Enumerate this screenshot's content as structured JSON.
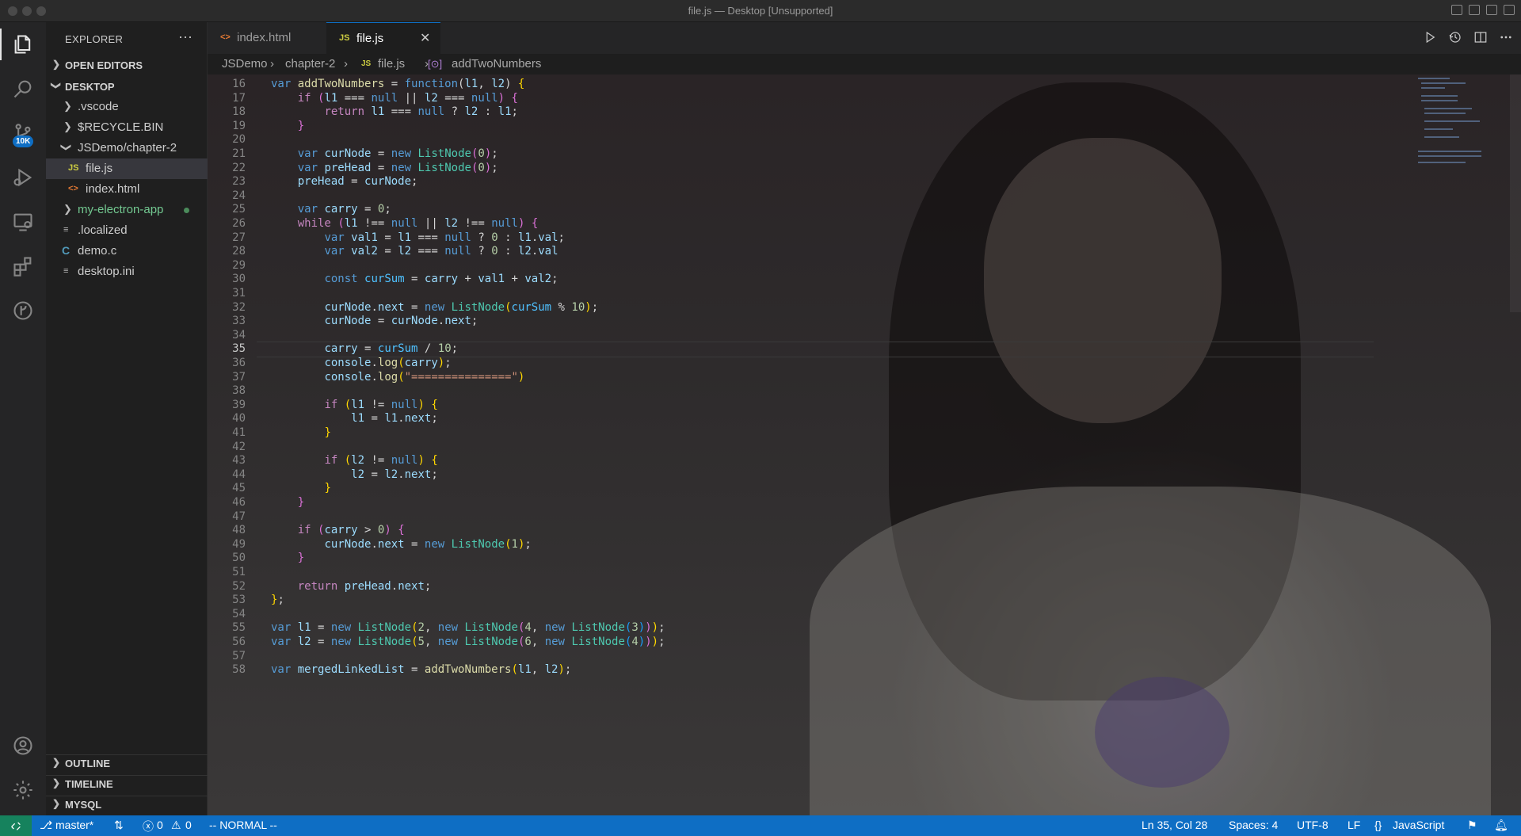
{
  "window": {
    "title": "file.js — Desktop [Unsupported]"
  },
  "sidebar": {
    "title": "EXPLORER",
    "more": "···",
    "sections": {
      "open_editors": "OPEN EDITORS",
      "desktop": "DESKTOP",
      "outline": "OUTLINE",
      "timeline": "TIMELINE",
      "mysql": "MYSQL"
    },
    "tree": [
      {
        "label": ".vscode",
        "kind": "folder"
      },
      {
        "label": "$RECYCLE.BIN",
        "kind": "folder"
      },
      {
        "label": "JSDemo/chapter-2",
        "kind": "folder-open"
      },
      {
        "label": "file.js",
        "kind": "js"
      },
      {
        "label": "index.html",
        "kind": "html"
      },
      {
        "label": "my-electron-app",
        "kind": "folder-git"
      },
      {
        "label": ".localized",
        "kind": "file"
      },
      {
        "label": "demo.c",
        "kind": "c"
      },
      {
        "label": "desktop.ini",
        "kind": "file"
      }
    ]
  },
  "activity": {
    "scm_badge": "10K"
  },
  "tabs": [
    {
      "label": "index.html",
      "icon": "<>",
      "active": false
    },
    {
      "label": "file.js",
      "icon": "JS",
      "active": true
    }
  ],
  "tab_close": "✕",
  "breadcrumb": {
    "root": "JSDemo",
    "folder": "chapter-2",
    "file_icon": "JS",
    "file": "file.js",
    "symbol": "addTwoNumbers"
  },
  "editor": {
    "current_line": 35,
    "lines": [
      {
        "n": "16",
        "html": "<span style='color:#569cd6'>var</span> <span style='color:#dcdcaa'>addTwoNumbers</span> = <span style='color:#569cd6'>function</span>(<span style='color:#9cdcfe'>l1</span>, <span style='color:#9cdcfe'>l2</span>) <span style='color:#ffd700'>{</span>"
      },
      {
        "n": "17",
        "html": "    <span style='color:#c586c0'>if</span> <span style='color:#da70d6'>(</span><span style='color:#9cdcfe'>l1</span> === <span style='color:#569cd6'>null</span> || <span style='color:#9cdcfe'>l2</span> === <span style='color:#569cd6'>null</span><span style='color:#da70d6'>)</span> <span style='color:#da70d6'>{</span>"
      },
      {
        "n": "18",
        "html": "        <span style='color:#c586c0'>return</span> <span style='color:#9cdcfe'>l1</span> === <span style='color:#569cd6'>null</span> ? <span style='color:#9cdcfe'>l2</span> : <span style='color:#9cdcfe'>l1</span>;"
      },
      {
        "n": "19",
        "html": "    <span style='color:#da70d6'>}</span>"
      },
      {
        "n": "20",
        "html": ""
      },
      {
        "n": "21",
        "html": "    <span style='color:#569cd6'>var</span> <span style='color:#9cdcfe'>curNode</span> = <span style='color:#569cd6'>new</span> <span style='color:#4ec9b0'>ListNode</span><span style='color:#da70d6'>(</span><span style='color:#b5cea8'>0</span><span style='color:#da70d6'>)</span>;"
      },
      {
        "n": "22",
        "html": "    <span style='color:#569cd6'>var</span> <span style='color:#9cdcfe'>preHead</span> = <span style='color:#569cd6'>new</span> <span style='color:#4ec9b0'>ListNode</span><span style='color:#da70d6'>(</span><span style='color:#b5cea8'>0</span><span style='color:#da70d6'>)</span>;"
      },
      {
        "n": "23",
        "html": "    <span style='color:#9cdcfe'>preHead</span> = <span style='color:#9cdcfe'>curNode</span>;"
      },
      {
        "n": "24",
        "html": ""
      },
      {
        "n": "25",
        "html": "    <span style='color:#569cd6'>var</span> <span style='color:#9cdcfe'>carry</span> = <span style='color:#b5cea8'>0</span>;"
      },
      {
        "n": "26",
        "html": "    <span style='color:#c586c0'>while</span> <span style='color:#da70d6'>(</span><span style='color:#9cdcfe'>l1</span> !== <span style='color:#569cd6'>null</span> || <span style='color:#9cdcfe'>l2</span> !== <span style='color:#569cd6'>null</span><span style='color:#da70d6'>)</span> <span style='color:#da70d6'>{</span>"
      },
      {
        "n": "27",
        "html": "        <span style='color:#569cd6'>var</span> <span style='color:#9cdcfe'>val1</span> = <span style='color:#9cdcfe'>l1</span> === <span style='color:#569cd6'>null</span> ? <span style='color:#b5cea8'>0</span> : <span style='color:#9cdcfe'>l1</span>.<span style='color:#9cdcfe'>val</span>;"
      },
      {
        "n": "28",
        "html": "        <span style='color:#569cd6'>var</span> <span style='color:#9cdcfe'>val2</span> = <span style='color:#9cdcfe'>l2</span> === <span style='color:#569cd6'>null</span> ? <span style='color:#b5cea8'>0</span> : <span style='color:#9cdcfe'>l2</span>.<span style='color:#9cdcfe'>val</span>"
      },
      {
        "n": "29",
        "html": ""
      },
      {
        "n": "30",
        "html": "        <span style='color:#569cd6'>const</span> <span style='color:#4fc1ff'>curSum</span> = <span style='color:#9cdcfe'>carry</span> + <span style='color:#9cdcfe'>val1</span> + <span style='color:#9cdcfe'>val2</span>;"
      },
      {
        "n": "31",
        "html": ""
      },
      {
        "n": "32",
        "html": "        <span style='color:#9cdcfe'>curNode</span>.<span style='color:#9cdcfe'>next</span> = <span style='color:#569cd6'>new</span> <span style='color:#4ec9b0'>ListNode</span><span style='color:#ffd700'>(</span><span style='color:#4fc1ff'>curSum</span> % <span style='color:#b5cea8'>10</span><span style='color:#ffd700'>)</span>;"
      },
      {
        "n": "33",
        "html": "        <span style='color:#9cdcfe'>curNode</span> = <span style='color:#9cdcfe'>curNode</span>.<span style='color:#9cdcfe'>next</span>;"
      },
      {
        "n": "34",
        "html": ""
      },
      {
        "n": "35",
        "html": "        <span style='color:#9cdcfe'>carry</span> = <span style='color:#4fc1ff'>curSum</span> / <span style='color:#b5cea8'>10</span>;"
      },
      {
        "n": "36",
        "html": "        <span style='color:#9cdcfe'>console</span>.<span style='color:#dcdcaa'>log</span><span style='color:#ffd700'>(</span><span style='color:#9cdcfe'>carry</span><span style='color:#ffd700'>)</span>;"
      },
      {
        "n": "37",
        "html": "        <span style='color:#9cdcfe'>console</span>.<span style='color:#dcdcaa'>log</span><span style='color:#ffd700'>(</span><span style='color:#ce9178'>\"===============\"</span><span style='color:#ffd700'>)</span>"
      },
      {
        "n": "38",
        "html": ""
      },
      {
        "n": "39",
        "html": "        <span style='color:#c586c0'>if</span> <span style='color:#ffd700'>(</span><span style='color:#9cdcfe'>l1</span> != <span style='color:#569cd6'>null</span><span style='color:#ffd700'>)</span> <span style='color:#ffd700'>{</span>"
      },
      {
        "n": "40",
        "html": "            <span style='color:#9cdcfe'>l1</span> = <span style='color:#9cdcfe'>l1</span>.<span style='color:#9cdcfe'>next</span>;"
      },
      {
        "n": "41",
        "html": "        <span style='color:#ffd700'>}</span>"
      },
      {
        "n": "42",
        "html": ""
      },
      {
        "n": "43",
        "html": "        <span style='color:#c586c0'>if</span> <span style='color:#ffd700'>(</span><span style='color:#9cdcfe'>l2</span> != <span style='color:#569cd6'>null</span><span style='color:#ffd700'>)</span> <span style='color:#ffd700'>{</span>"
      },
      {
        "n": "44",
        "html": "            <span style='color:#9cdcfe'>l2</span> = <span style='color:#9cdcfe'>l2</span>.<span style='color:#9cdcfe'>next</span>;"
      },
      {
        "n": "45",
        "html": "        <span style='color:#ffd700'>}</span>"
      },
      {
        "n": "46",
        "html": "    <span style='color:#da70d6'>}</span>"
      },
      {
        "n": "47",
        "html": ""
      },
      {
        "n": "48",
        "html": "    <span style='color:#c586c0'>if</span> <span style='color:#da70d6'>(</span><span style='color:#9cdcfe'>carry</span> &gt; <span style='color:#b5cea8'>0</span><span style='color:#da70d6'>)</span> <span style='color:#da70d6'>{</span>"
      },
      {
        "n": "49",
        "html": "        <span style='color:#9cdcfe'>curNode</span>.<span style='color:#9cdcfe'>next</span> = <span style='color:#569cd6'>new</span> <span style='color:#4ec9b0'>ListNode</span><span style='color:#ffd700'>(</span><span style='color:#b5cea8'>1</span><span style='color:#ffd700'>)</span>;"
      },
      {
        "n": "50",
        "html": "    <span style='color:#da70d6'>}</span>"
      },
      {
        "n": "51",
        "html": ""
      },
      {
        "n": "52",
        "html": "    <span style='color:#c586c0'>return</span> <span style='color:#9cdcfe'>preHead</span>.<span style='color:#9cdcfe'>next</span>;"
      },
      {
        "n": "53",
        "html": "<span style='color:#ffd700'>}</span>;"
      },
      {
        "n": "54",
        "html": ""
      },
      {
        "n": "55",
        "html": "<span style='color:#569cd6'>var</span> <span style='color:#9cdcfe'>l1</span> = <span style='color:#569cd6'>new</span> <span style='color:#4ec9b0'>ListNode</span><span style='color:#ffd700'>(</span><span style='color:#b5cea8'>2</span>, <span style='color:#569cd6'>new</span> <span style='color:#4ec9b0'>ListNode</span><span style='color:#da70d6'>(</span><span style='color:#b5cea8'>4</span>, <span style='color:#569cd6'>new</span> <span style='color:#4ec9b0'>ListNode</span><span style='color:#179fff'>(</span><span style='color:#b5cea8'>3</span><span style='color:#179fff'>)</span><span style='color:#da70d6'>)</span><span style='color:#ffd700'>)</span>;"
      },
      {
        "n": "56",
        "html": "<span style='color:#569cd6'>var</span> <span style='color:#9cdcfe'>l2</span> = <span style='color:#569cd6'>new</span> <span style='color:#4ec9b0'>ListNode</span><span style='color:#ffd700'>(</span><span style='color:#b5cea8'>5</span>, <span style='color:#569cd6'>new</span> <span style='color:#4ec9b0'>ListNode</span><span style='color:#da70d6'>(</span><span style='color:#b5cea8'>6</span>, <span style='color:#569cd6'>new</span> <span style='color:#4ec9b0'>ListNode</span><span style='color:#179fff'>(</span><span style='color:#b5cea8'>4</span><span style='color:#179fff'>)</span><span style='color:#da70d6'>)</span><span style='color:#ffd700'>)</span>;"
      },
      {
        "n": "57",
        "html": ""
      },
      {
        "n": "58",
        "html": "<span style='color:#569cd6'>var</span> <span style='color:#9cdcfe'>mergedLinkedList</span> = <span style='color:#dcdcaa'>addTwoNumbers</span><span style='color:#ffd700'>(</span><span style='color:#9cdcfe'>l1</span>, <span style='color:#9cdcfe'>l2</span><span style='color:#ffd700'>)</span>;"
      }
    ]
  },
  "status": {
    "branch": "master*",
    "errors": "0",
    "warnings": "0",
    "mode": "-- NORMAL --",
    "position": "Ln 35, Col 28",
    "spaces": "Spaces: 4",
    "encoding": "UTF-8",
    "eol": "LF",
    "language": "JavaScript"
  },
  "colors": {
    "accent": "#0e6ec4",
    "remote": "#16825d",
    "git_green": "#73c991"
  }
}
